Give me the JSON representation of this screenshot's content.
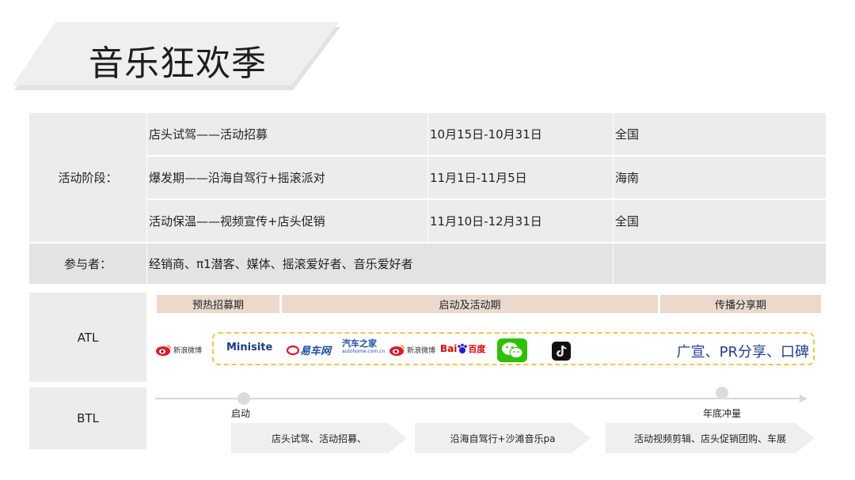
{
  "page": {
    "title": "音乐狂欢季"
  },
  "stages": {
    "label": "活动阶段：",
    "rows": [
      {
        "name": "店头试驾——活动招募",
        "date": "10月15日-10月31日",
        "region": "全国"
      },
      {
        "name": "爆发期——沿海自驾行+摇滚派对",
        "date": "11月1日-11月5日",
        "region": "海南"
      },
      {
        "name": "活动保温——视频宣传+店头促销",
        "date": "11月10日-12月31日",
        "region": "全国"
      }
    ]
  },
  "participants": {
    "label": "参与者：",
    "value": "经销商、π1潜客、媒体、摇滚爱好者、音乐爱好者"
  },
  "phases": {
    "warmup": "预热招募期",
    "launch": "启动及活动期",
    "share": "传播分享期"
  },
  "atl": {
    "label": "ATL",
    "logos": {
      "weibo1": "新浪微博",
      "minisite": "Minisite",
      "yiche": "易车网",
      "autohome_main": "汽车之家",
      "autohome_sub": "autohome.com.cn",
      "weibo2": "新浪微博",
      "baidu_a": "Bai",
      "baidu_b": "百度"
    },
    "pr_text": "广宣、PR分享、口碑"
  },
  "btl": {
    "label": "BTL",
    "timeline": {
      "start_label": "启动",
      "end_label": "年底冲量"
    },
    "steps": [
      "店头试驾、活动招募、",
      "沿海自驾行+沙滩音乐pa",
      "活动视频剪辑、店头促销团购、车展"
    ]
  },
  "colors": {
    "phase_bar": "#ead9cc",
    "dash_border": "#f0c64a",
    "pr_text": "#1f3f8f",
    "weibo_red": "#e6162d",
    "yiche_blue": "#1a4fa0",
    "autohome_blue": "#1d4fa3",
    "wechat_green": "#2dc100"
  }
}
